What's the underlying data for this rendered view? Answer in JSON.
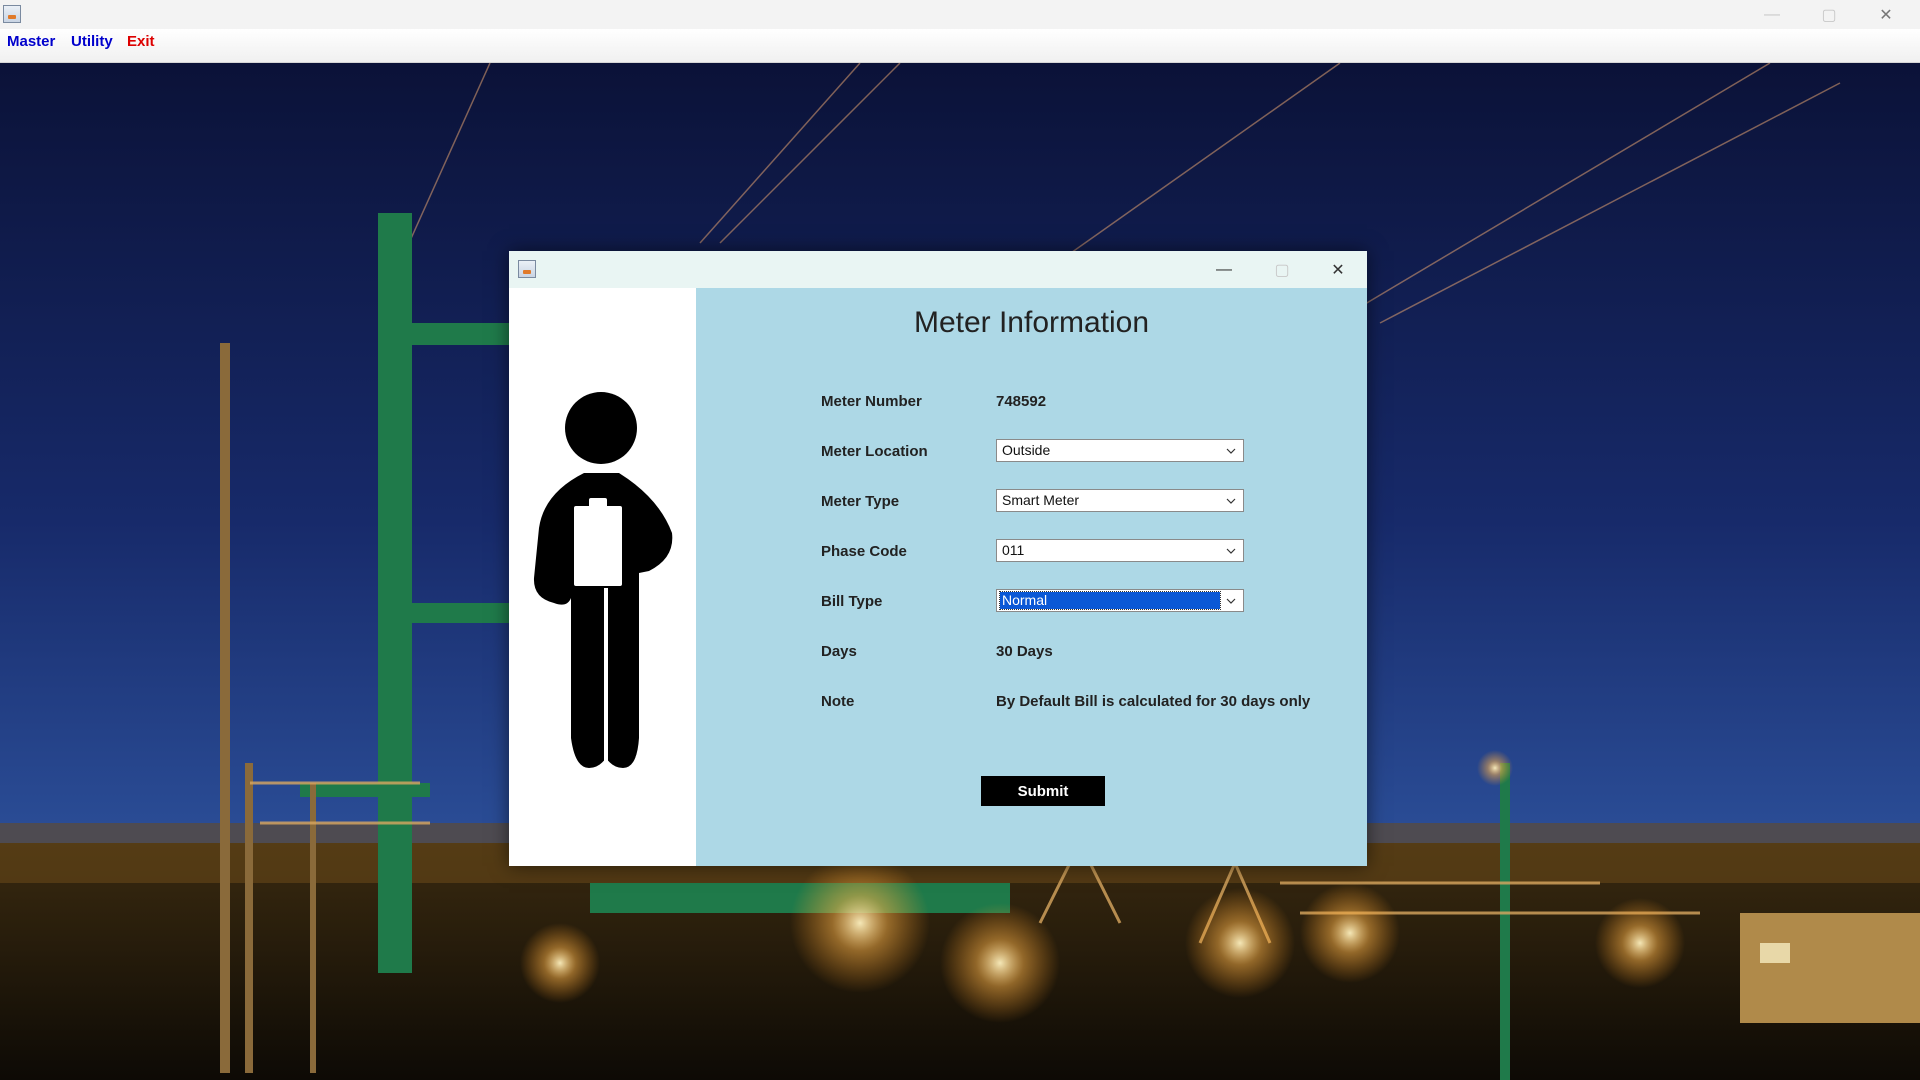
{
  "app": {
    "minimize_glyph": "—",
    "maximize_glyph": "▢",
    "close_glyph": "✕"
  },
  "menubar": {
    "items": [
      {
        "label": "Master",
        "color": "#0000cc"
      },
      {
        "label": "Utility",
        "color": "#0000cc"
      },
      {
        "label": "Exit",
        "color": "#dd0000"
      }
    ]
  },
  "dialog": {
    "title": "Meter Information",
    "fields": {
      "meter_number": {
        "label": "Meter Number",
        "value": "748592"
      },
      "meter_location": {
        "label": "Meter Location",
        "value": "Outside"
      },
      "meter_type": {
        "label": "Meter Type",
        "value": "Smart Meter"
      },
      "phase_code": {
        "label": "Phase Code",
        "value": "011"
      },
      "bill_type": {
        "label": "Bill Type",
        "value": "Normal"
      },
      "days": {
        "label": "Days",
        "value": "30 Days"
      },
      "note": {
        "label": "Note",
        "value": "By Default Bill is calculated for 30 days only"
      }
    },
    "submit_label": "Submit"
  },
  "colors": {
    "form_bg": "#add8e6",
    "menu_blue": "#0000cc",
    "menu_red": "#dd0000",
    "selection": "#0a58d6"
  },
  "icons": {
    "app": "java-app-icon",
    "illustration": "person-with-clipboard-icon",
    "background": "electrical-substation-night-photo"
  }
}
